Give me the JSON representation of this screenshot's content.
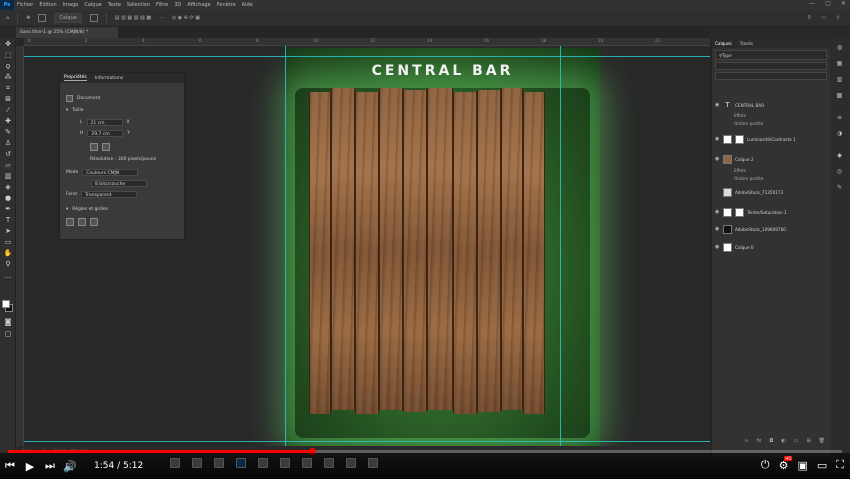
{
  "menubar": {
    "logo": "Ps",
    "items": [
      "Fichier",
      "Édition",
      "Image",
      "Calque",
      "Texte",
      "Sélection",
      "Filtre",
      "3D",
      "Affichage",
      "Fenêtre",
      "Aide"
    ],
    "window_controls": [
      "—",
      "▢",
      "✕"
    ]
  },
  "options": {
    "layer_select": "Calque"
  },
  "document": {
    "tab_label": "Sans titre-1 @ 25% (CMJN/8) *",
    "title": "CENTRAL BAR"
  },
  "ruler": {
    "ticks": [
      "0",
      "2",
      "4",
      "6",
      "8",
      "10",
      "12",
      "14",
      "16",
      "18",
      "20",
      "22"
    ]
  },
  "properties": {
    "tabs": [
      "Propriétés",
      "Informations"
    ],
    "doc_label": "Document",
    "section_size": "Taille",
    "width_label": "L",
    "width_value": "21 cm",
    "height_label": "H",
    "height_value": "29,7 cm",
    "x_label": "X",
    "y_label": "Y",
    "resolution": "Résolution : 300 pixels/pouce",
    "mode_label": "Mode",
    "mode_value": "Couleurs CMJN",
    "bits_value": "8 bits/couche",
    "bg_label": "Fond",
    "bg_value": "Transparent",
    "section_guides": "Règles et grilles"
  },
  "layers_panel": {
    "tabs": [
      "Calques",
      "Tracés"
    ],
    "filter_label": "Type",
    "layers": [
      {
        "name": "CENTRAL BAR",
        "kind": "text"
      },
      {
        "name": "Effets",
        "kind": "sub"
      },
      {
        "name": "Ombre portée",
        "kind": "sub"
      },
      {
        "name": "Luminosité/Contraste 1",
        "kind": "adjust"
      },
      {
        "name": "Calque 2",
        "kind": "wood"
      },
      {
        "name": "Effets",
        "kind": "sub"
      },
      {
        "name": "Ombre portée",
        "kind": "sub"
      },
      {
        "name": "AdobeStock_71350173",
        "kind": "image"
      },
      {
        "name": "Teinte/Saturation 1",
        "kind": "adjust"
      },
      {
        "name": "AdobeStock_109609780",
        "kind": "dark"
      },
      {
        "name": "Calque 0",
        "kind": "white"
      }
    ]
  },
  "status": {
    "zoom": "25 %",
    "doc_info": "Doc : 37,2 Mo/221,3 Mo"
  },
  "player": {
    "time": "1:54 / 5:12",
    "progress": 0.365,
    "hd_badge": "HD"
  },
  "colors": {
    "accent": "#31a8ff",
    "guide": "#27c7c7",
    "progress": "#ff0000"
  }
}
